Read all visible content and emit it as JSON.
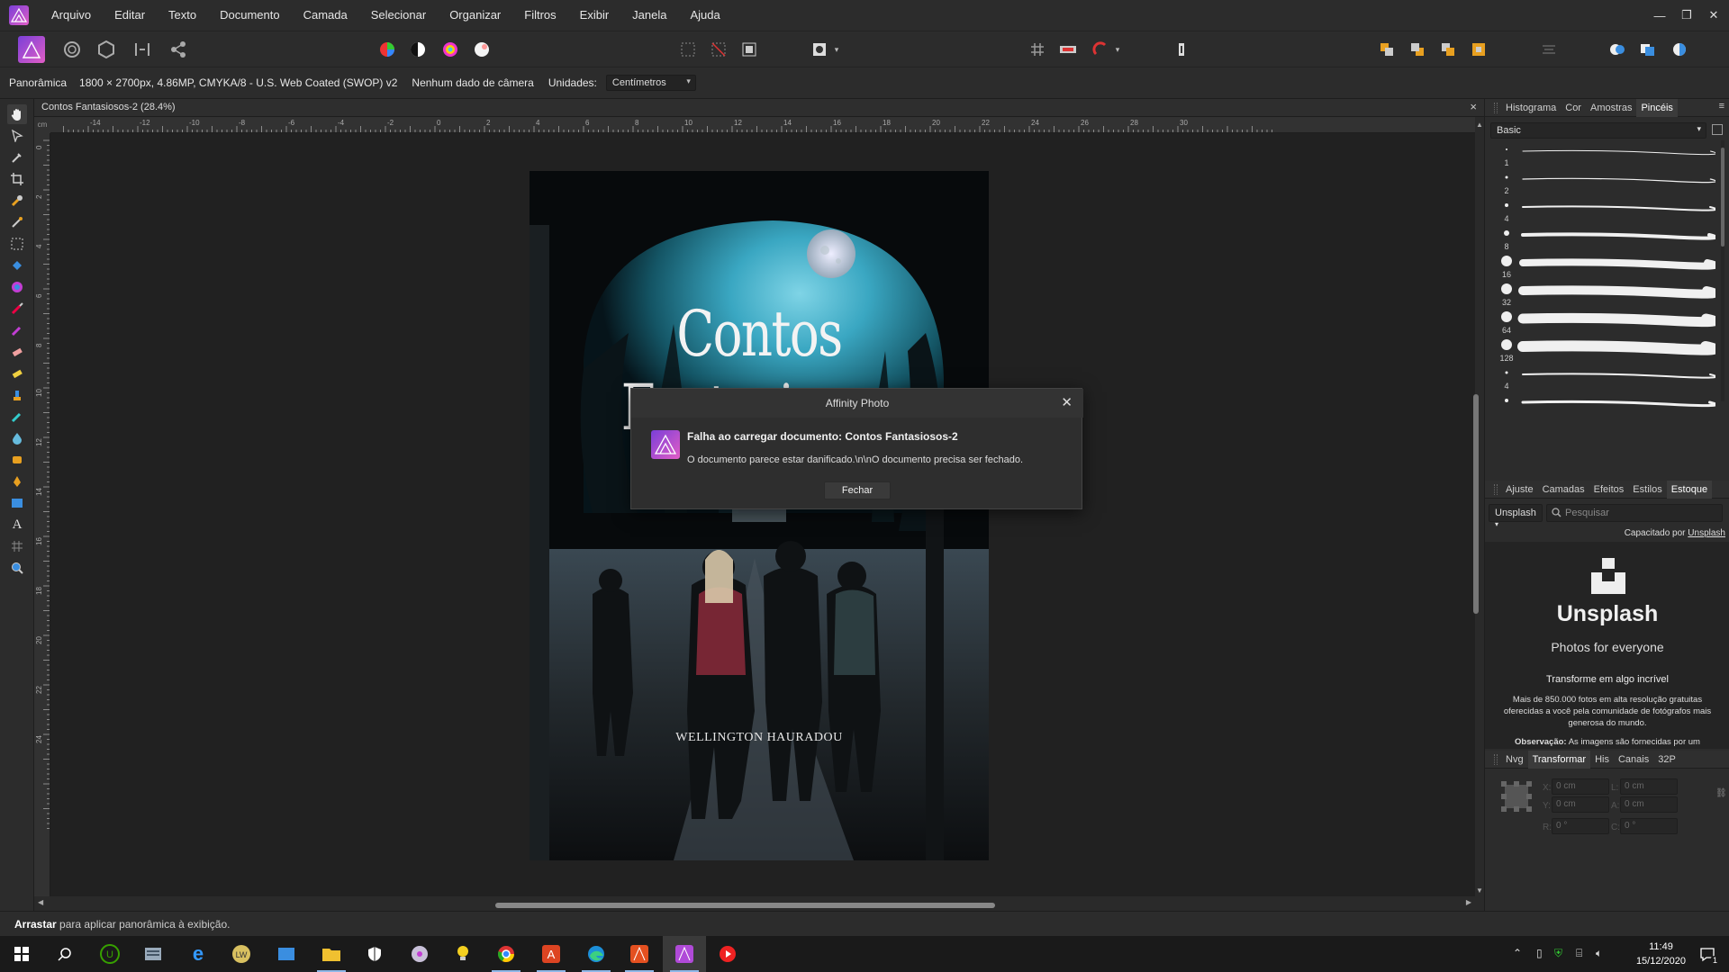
{
  "menubar": {
    "items": [
      "Arquivo",
      "Editar",
      "Texto",
      "Documento",
      "Camada",
      "Selecionar",
      "Organizar",
      "Filtros",
      "Exibir",
      "Janela",
      "Ajuda"
    ]
  },
  "context": {
    "tool": "Panorâmica",
    "doc_info": "1800 × 2700px, 4.86MP, CMYKA/8 - U.S. Web Coated (SWOP) v2",
    "camera": "Nenhum dado de câmera",
    "units_label": "Unidades:",
    "units_value": "Centímetros"
  },
  "document": {
    "tab_title": "Contos Fantasiosos-2 (28.4%)",
    "cover_title": "Contos Fantasiosos",
    "cover_author": "WELLINGTON HAURADOU"
  },
  "ruler": {
    "unit": "cm",
    "h_ticks": [
      "-14",
      "-12",
      "-10",
      "-8",
      "-6",
      "-4",
      "-2",
      "0",
      "2",
      "4",
      "6",
      "8",
      "10",
      "12",
      "14",
      "16",
      "18",
      "20",
      "22",
      "24",
      "26",
      "28",
      "30"
    ],
    "v_ticks": [
      "0",
      "2",
      "4",
      "6",
      "8",
      "10",
      "12",
      "14",
      "16",
      "18",
      "20",
      "22",
      "24"
    ]
  },
  "panel_top": {
    "tabs": [
      "Histograma",
      "Cor",
      "Amostras",
      "Pincéis"
    ],
    "active": "Pincéis",
    "category": "Basic",
    "brush_sizes": [
      "1",
      "2",
      "4",
      "8",
      "16",
      "32",
      "64",
      "128",
      "4",
      ""
    ]
  },
  "panel_mid": {
    "tabs": [
      "Ajuste",
      "Camadas",
      "Efeitos",
      "Estilos",
      "Estoque"
    ],
    "active": "Estoque",
    "source": "Unsplash",
    "search_placeholder": "Pesquisar",
    "powered_prefix": "Capacitado por",
    "powered_link": "Unsplash",
    "brand": "Unsplash",
    "tagline": "Photos for everyone",
    "headline": "Transforme em algo incrível",
    "para1": "Mais de 850.000 fotos em alta resolução gratuitas oferecidas a você pela comunidade de fotógrafos mais generosa do mundo.",
    "note_label": "Observação:",
    "para2": "As imagens são fornecidas por um terceiro denominado Unsplash; elas não são fornecidas pela Serif. Ao adicionar as imagens ao seu projeto, você aceita os Unsplash Termos e condições"
  },
  "panel_bottom": {
    "tabs": [
      "Nvg",
      "Transformar",
      "His",
      "Canais",
      "32P"
    ],
    "active": "Transformar",
    "fields": {
      "x": "0 cm",
      "y": "0 cm",
      "w": "0 cm",
      "h": "0 cm",
      "r": "0 °",
      "s": "0 °"
    },
    "labels": {
      "x": "X:",
      "y": "Y:",
      "w": "L:",
      "h": "A:",
      "r": "R:",
      "s": "C:"
    }
  },
  "status": {
    "bold": "Arrastar",
    "text": " para aplicar panorâmica à exibição."
  },
  "dialog": {
    "title": "Affinity Photo",
    "heading": "Falha ao carregar documento: Contos Fantasiosos-2",
    "message": "O documento parece estar danificado.\\n\\nO documento precisa ser fechado.",
    "button": "Fechar"
  },
  "taskbar": {
    "time": "11:49",
    "date": "15/12/2020",
    "notifications": "1"
  },
  "colors": {
    "accent_affinity": "#c04bd6",
    "canvas_bg": "#212121",
    "panel_bg": "#2c2c2c",
    "moon_sky": "#3aa7c2"
  }
}
